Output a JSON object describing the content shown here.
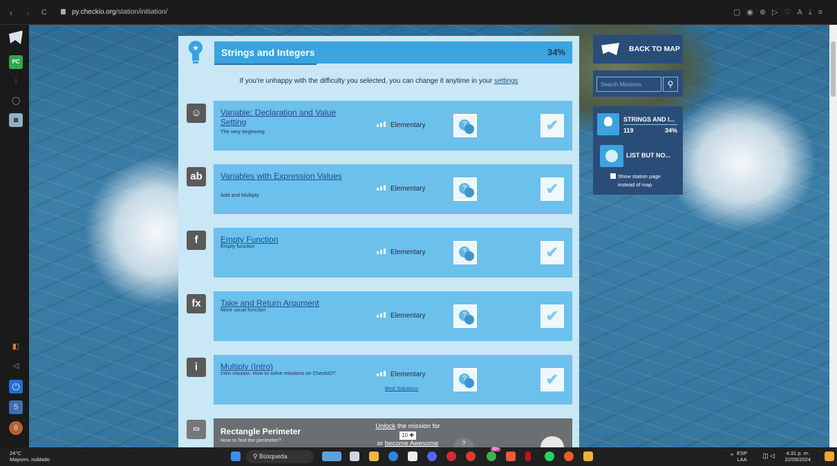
{
  "browser": {
    "url_host": "py.checkio.org",
    "url_path": "/station/initiation/"
  },
  "sidebar": {
    "badge_a": "5",
    "badge_b": "8"
  },
  "station": {
    "title": "Strings and Integers",
    "progress": "34%",
    "notice_text": "If you're unhappy with the difficulty you selected, you can change it anytime in your ",
    "notice_link": "settings"
  },
  "missions": [
    {
      "title": "Variable: Declaration and Value Setting",
      "subtitle": "The very beginning",
      "level": "Elementary",
      "icon": "smile-icon",
      "icon_text": "☺"
    },
    {
      "title": "Variables with Expression Values",
      "subtitle": "Add and Multiply",
      "level": "Elementary",
      "icon": "abc-icon",
      "icon_text": "ab"
    },
    {
      "title": "Empty Function",
      "subtitle": "Empty function",
      "level": "Elementary",
      "icon": "function-icon",
      "icon_text": "f"
    },
    {
      "title": "Take and Return Argument",
      "subtitle": "More usual function",
      "level": "Elementary",
      "icon": "fx-icon",
      "icon_text": "fx"
    },
    {
      "title": "Multiply (Intro)",
      "subtitle": "Intro mission. How to solve missions on CheckiO?",
      "level": "Elementary",
      "icon": "info-icon",
      "icon_text": "i",
      "best_solutions": "Best Solutions"
    }
  ],
  "locked_mission": {
    "title": "Rectangle Perimeter",
    "subtitle": "How to find the perimeter?",
    "unlock_link": "Unlock",
    "unlock_text": " the mission for",
    "cost": "10",
    "or_text": "or ",
    "awesome_link": "become Awesome"
  },
  "right_panel": {
    "back_label": "BACK TO MAP",
    "search_placeholder": "Search Missions",
    "station1_name": "STRINGS AND I...",
    "station1_count": "119",
    "station1_pct": "34%",
    "station2_name": "LIST BUT NO...",
    "show_station_label": "Show station page instead of map"
  },
  "taskbar": {
    "weather_temp": "24°C",
    "weather_desc": "Mayorm. nublado",
    "search_label": "Búsqueda",
    "lang": "ESP",
    "lang2": "LAA",
    "time": "4:31 p. m.",
    "date": "22/09/2024",
    "notif_count": "99+"
  },
  "colors": {
    "accent": "#3aa3e0",
    "mission_bg": "#6cc0ec",
    "panel_bg": "#c9e7f5",
    "nav_bg": "#2a4d78"
  }
}
